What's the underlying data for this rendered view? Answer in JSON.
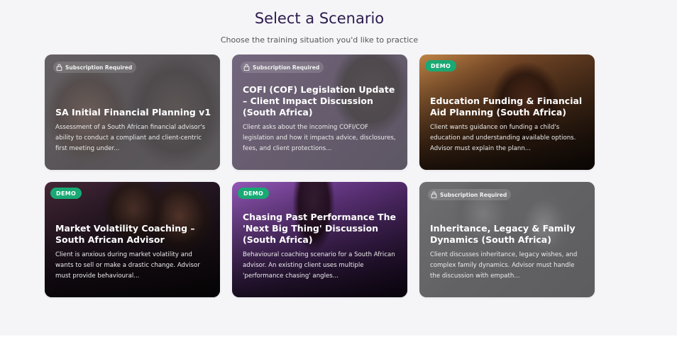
{
  "header": {
    "title": "Select a Scenario",
    "subtitle": "Choose the training situation you'd like to practice"
  },
  "badges": {
    "locked": "Subscription Required",
    "demo": "DEMO"
  },
  "colors": {
    "title": "#2d1b4e",
    "demo_badge": "#19a974",
    "page_background": "#f5f5f8"
  },
  "scenarios": [
    {
      "title": "SA Initial Financial Planning v1",
      "description": "Assessment of a South African financial advisor's ability to conduct a compliant and client-centric first meeting under...",
      "status": "locked"
    },
    {
      "title": "COFI (COF) Legislation Update – Client Impact Discussion (South Africa)",
      "description": "Client asks about the incoming COFI/COF legislation and how it impacts advice, disclosures, fees, and client protections...",
      "status": "locked"
    },
    {
      "title": "Education Funding & Financial Aid Planning (South Africa)",
      "description": "Client wants guidance on funding a child's education and understanding available options. Advisor must explain the plann...",
      "status": "demo"
    },
    {
      "title": "Market Volatility Coaching – South African Advisor",
      "description": "Client is anxious during market volatility and wants to sell or make a drastic change. Advisor must provide behavioural...",
      "status": "demo"
    },
    {
      "title": "Chasing Past Performance The 'Next Big Thing' Discussion (South Africa)",
      "description": "Behavioural coaching scenario for a South African advisor. An existing client uses multiple 'performance chasing' angles...",
      "status": "demo"
    },
    {
      "title": "Inheritance, Legacy & Family Dynamics (South Africa)",
      "description": "Client discusses inheritance, legacy wishes, and complex family dynamics. Advisor must handle the discussion with empath...",
      "status": "locked"
    }
  ]
}
